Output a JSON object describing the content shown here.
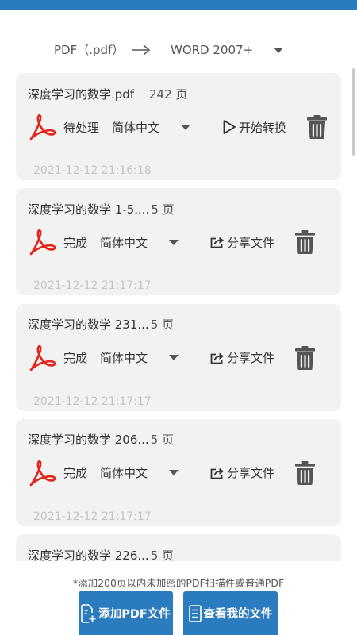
{
  "colors": {
    "accent": "#2b7bbf",
    "card_background": "#f2f2f2",
    "pdf_red": "#e1251b",
    "icon_gray": "#555555",
    "timestamp_gray": "#c4c4c4"
  },
  "conversion": {
    "source_format": "PDF（.pdf）",
    "arrow_icon": "arrow-right-icon",
    "target_format": "WORD 2007+",
    "target_dropdown_icon": "dropdown-triangle-icon"
  },
  "files": [
    {
      "name": "深度学习的数学.pdf",
      "pages": "242 页",
      "file_icon": "pdf-icon",
      "status": "待处理",
      "language": "简体中文",
      "language_dropdown_icon": "dropdown-triangle-icon",
      "action": "开始转换",
      "action_icon": "play-icon",
      "delete_icon": "trash-icon",
      "timestamp": "2021-12-12 21:16:18"
    },
    {
      "name": "深度学习的数学 1-5....",
      "pages": "5 页",
      "file_icon": "pdf-icon",
      "status": "完成",
      "language": "简体中文",
      "language_dropdown_icon": "dropdown-triangle-icon",
      "action": "分享文件",
      "action_icon": "share-icon",
      "delete_icon": "trash-icon",
      "timestamp": "2021-12-12 21:17:17"
    },
    {
      "name": "深度学习的数学 231...",
      "pages": "5 页",
      "file_icon": "pdf-icon",
      "status": "完成",
      "language": "简体中文",
      "language_dropdown_icon": "dropdown-triangle-icon",
      "action": "分享文件",
      "action_icon": "share-icon",
      "delete_icon": "trash-icon",
      "timestamp": "2021-12-12 21:17:17"
    },
    {
      "name": "深度学习的数学 206...",
      "pages": "5 页",
      "file_icon": "pdf-icon",
      "status": "完成",
      "language": "简体中文",
      "language_dropdown_icon": "dropdown-triangle-icon",
      "action": "分享文件",
      "action_icon": "share-icon",
      "delete_icon": "trash-icon",
      "timestamp": "2021-12-12 21:17:17"
    },
    {
      "name": "深度学习的数学 226...",
      "pages": "5 页"
    }
  ],
  "footer": {
    "note": "*添加200页以内未加密的PDF扫描件或普通PDF",
    "add_button_label": "添加PDF文件",
    "add_button_icon": "add-file-icon",
    "view_button_label": "查看我的文件",
    "view_button_icon": "file-list-icon"
  }
}
